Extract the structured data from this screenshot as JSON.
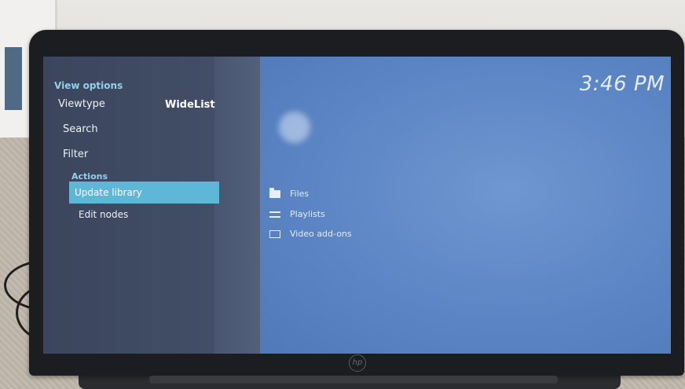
{
  "clock": {
    "time": "3:46 PM"
  },
  "sidebar": {
    "view_options_header": "View options",
    "viewtype_label": "Viewtype",
    "viewtype_value": "WideList",
    "search_label": "Search",
    "filter_label": "Filter",
    "actions_header": "Actions",
    "update_library_label": "Update library",
    "edit_nodes_label": "Edit nodes"
  },
  "library": {
    "items": [
      {
        "label": "Files",
        "icon": "folder-icon"
      },
      {
        "label": "Playlists",
        "icon": "playlist-icon"
      },
      {
        "label": "Video add-ons",
        "icon": "addon-icon"
      }
    ]
  },
  "colors": {
    "accent": "#5fb7d8",
    "header_text": "#8fd2ec",
    "menu_bg": "#3b465d",
    "content_bg": "#5b85c4"
  },
  "device": {
    "logo": "hp"
  }
}
